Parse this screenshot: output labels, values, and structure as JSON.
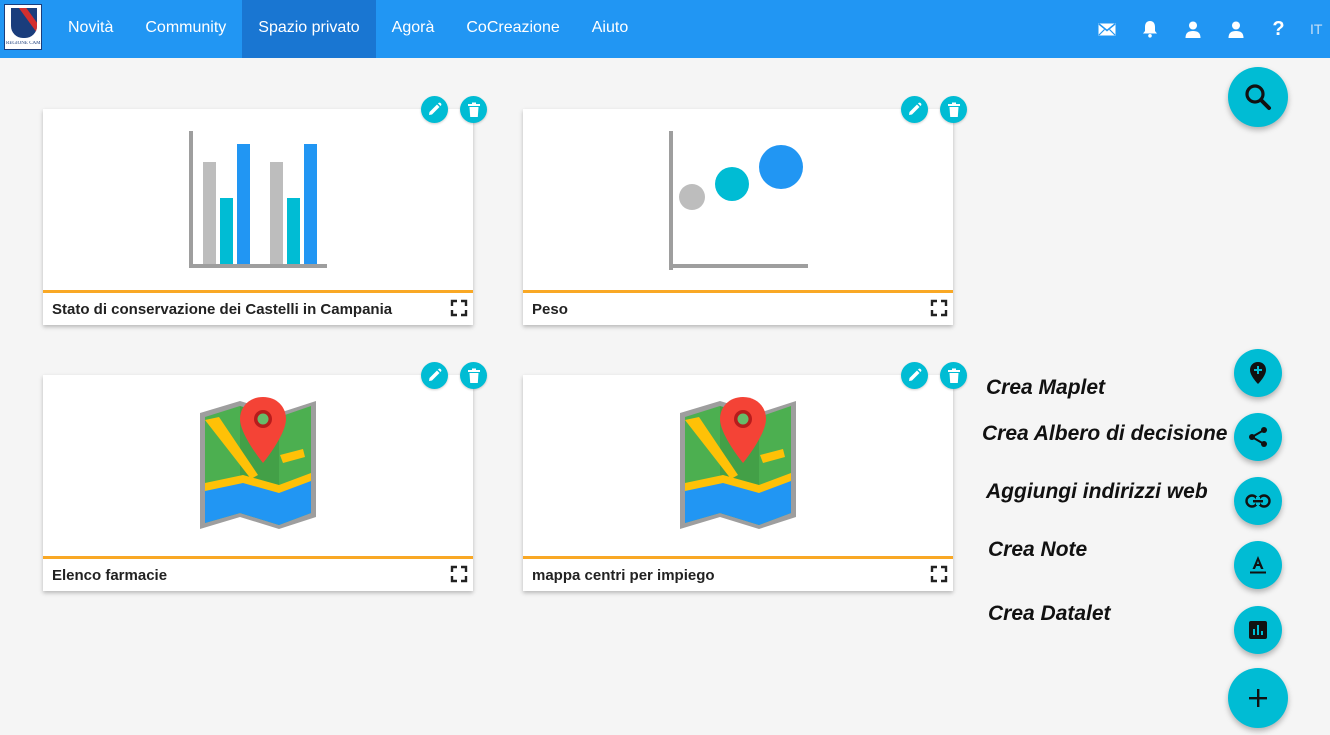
{
  "logo": {
    "caption": "REGIONE CAMPANIA"
  },
  "nav": {
    "items": [
      {
        "label": "Novità"
      },
      {
        "label": "Community"
      },
      {
        "label": "Spazio privato",
        "active": true
      },
      {
        "label": "Agorà"
      },
      {
        "label": "CoCreazione"
      },
      {
        "label": "Aiuto"
      }
    ]
  },
  "top_icons": [
    "mail-icon",
    "bell-icon",
    "user-icon",
    "user-icon",
    "help-icon"
  ],
  "help_label": "?",
  "language": "IT",
  "cards": [
    {
      "title": "Stato di conservazione dei Castelli in Campania",
      "preview": "bar-chart-icon"
    },
    {
      "title": "Peso",
      "preview": "bubble-chart-icon"
    },
    {
      "title": "Elenco farmacie",
      "preview": "map-icon"
    },
    {
      "title": "mappa centri per impiego",
      "preview": "map-icon"
    }
  ],
  "fab_actions": [
    {
      "label": "Crea Maplet",
      "icon": "add-location-icon"
    },
    {
      "label": "Crea Albero di decisione",
      "icon": "share-icon"
    },
    {
      "label": "Aggiungi indirizzi web",
      "icon": "link-icon"
    },
    {
      "label": "Crea Note",
      "icon": "text-format-icon"
    },
    {
      "label": "Crea Datalet",
      "icon": "bar-chart-icon"
    }
  ],
  "search_fab": {
    "icon": "search-icon"
  },
  "add_fab": {
    "icon": "plus-icon"
  },
  "colors": {
    "topbar": "#2196f3",
    "nav_active": "#1976d2",
    "accent": "#00bcd4",
    "card_divider": "#f9a825",
    "background": "#f5f5f5"
  }
}
